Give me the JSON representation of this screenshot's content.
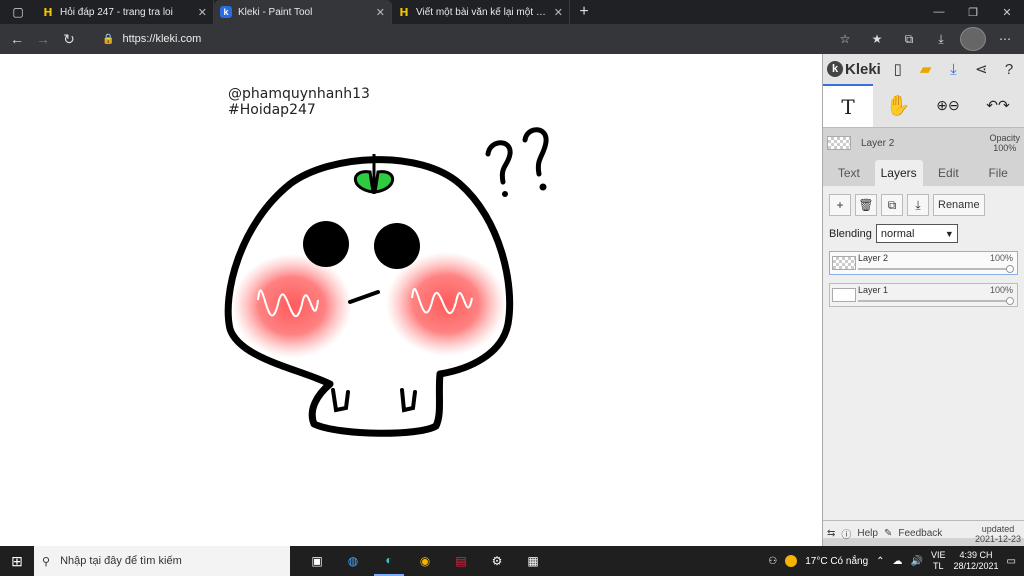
{
  "browser": {
    "tabs": [
      {
        "title": "Hỏi đáp 247 - trang tra loi",
        "icon": "h-icon",
        "active": false
      },
      {
        "title": "Kleki - Paint Tool",
        "icon": "k-icon",
        "active": true
      },
      {
        "title": "Viết một bài văn kể lại một lần e",
        "icon": "h-icon",
        "active": false
      }
    ],
    "url": "https://kleki.com"
  },
  "canvas": {
    "line1": "@phamquynhanh13",
    "line2": "#Hoidap247"
  },
  "panel": {
    "app_name": "Kleki",
    "layer_name": "Layer 2",
    "opacity_label": "Opacity",
    "opacity_value": "100%",
    "tabs": [
      "Text",
      "Layers",
      "Edit",
      "File"
    ],
    "rename_label": "Rename",
    "blending_label": "Blending",
    "blending_value": "normal",
    "layers": [
      {
        "name": "Layer 2",
        "opacity": "100%"
      },
      {
        "name": "Layer 1",
        "opacity": "100%"
      }
    ],
    "help_label": "Help",
    "feedback_label": "Feedback",
    "updated_label": "updated",
    "updated_date": "2021-12-23"
  },
  "taskbar": {
    "search_placeholder": "Nhập tại đây để tìm kiếm",
    "weather": "17°C  Có nắng",
    "lang1": "VIE",
    "lang2": "TL",
    "time": "4:39 CH",
    "date": "28/12/2021"
  },
  "colors": {
    "accent": "#3a6fd8",
    "leaf": "#2ecc40",
    "blush": "#ff5a5a"
  }
}
